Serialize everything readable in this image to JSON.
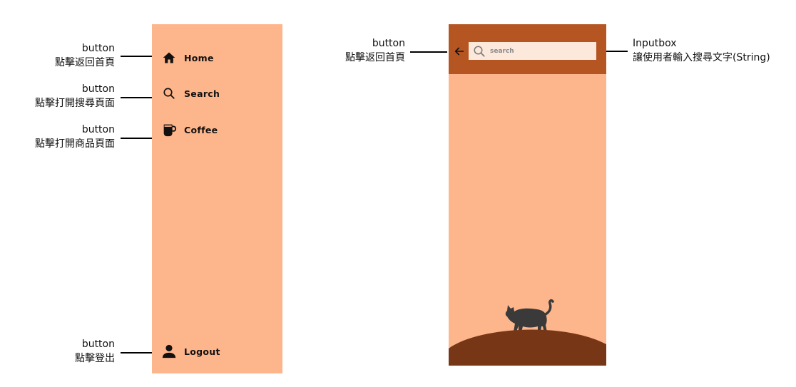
{
  "annotations": {
    "home": {
      "type": "button",
      "desc": "點擊返回首頁"
    },
    "search": {
      "type": "button",
      "desc": "點擊打開搜尋頁面"
    },
    "coffee": {
      "type": "button",
      "desc": "點擊打開商品頁面"
    },
    "logout": {
      "type": "button",
      "desc": "點擊登出"
    },
    "back": {
      "type": "button",
      "desc": "點擊返回首頁"
    },
    "inputbox": {
      "type": "Inputbox",
      "desc": "讓使用者輸入搜尋文字(String)"
    }
  },
  "sidebar": {
    "items": [
      {
        "label": "Home",
        "icon": "home-icon"
      },
      {
        "label": "Search",
        "icon": "search-icon"
      },
      {
        "label": "Coffee",
        "icon": "coffee-cup-icon"
      },
      {
        "label": "Logout",
        "icon": "person-icon"
      }
    ]
  },
  "search_screen": {
    "back_icon": "arrow-left-icon",
    "search_icon": "search-icon",
    "search_placeholder": "search",
    "search_value": ""
  },
  "colors": {
    "panel_bg": "#fdb58b",
    "appbar_bg": "#b55522",
    "searchbox_bg": "#fde8dc",
    "hill": "#773616",
    "cat": "#3a3a3a"
  }
}
